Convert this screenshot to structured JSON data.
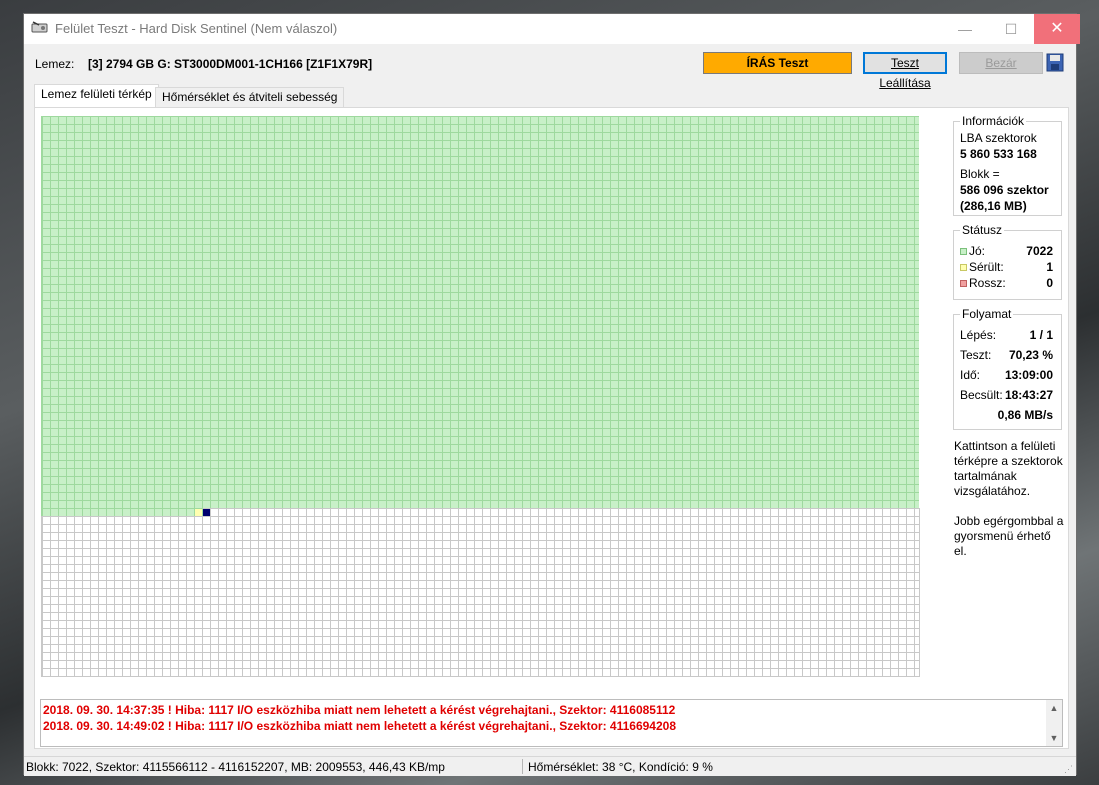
{
  "window": {
    "title": "Felület Teszt - Hard Disk Sentinel (Nem válaszol)",
    "minimize": "—",
    "maximize": "☐",
    "close": "✕"
  },
  "disk": {
    "label": "Lemez:",
    "value": "[3] 2794 GB G: ST3000DM001-1CH166 [Z1F1X79R]"
  },
  "buttons": {
    "test": "ÍRÁS Teszt",
    "stop": "Teszt Leállítása",
    "close": "Bezár"
  },
  "tabs": [
    {
      "label": "Lemez felületi térkép"
    },
    {
      "label": "Hőmérséklet és átviteli sebesség"
    }
  ],
  "info": {
    "title": "Információk",
    "lba_label": "LBA szektorok",
    "lba_value": "5 860 533 168",
    "block_label": "Blokk =",
    "block_value": "586 096 szektor",
    "block_mb": "(286,16 MB)"
  },
  "status": {
    "title": "Státusz",
    "good_label": "Jó:",
    "good_value": "7022",
    "damaged_label": "Sérült:",
    "damaged_value": "1",
    "bad_label": "Rossz:",
    "bad_value": "0"
  },
  "progress": {
    "title": "Folyamat",
    "step_label": "Lépés:",
    "step_value": "1 / 1",
    "test_label": "Teszt:",
    "test_value": "70,23 %",
    "time_label": "Idő:",
    "time_value": "13:09:00",
    "est_label": "Becsült:",
    "est_value": "18:43:27",
    "speed": "0,86 MB/s"
  },
  "hints": {
    "hint1": "Kattintson a felületi térképre a szektorok tartalmának vizsgálatához.",
    "hint2": "Jobb egérgombbal a gyorsmenü érhető el."
  },
  "log": [
    "2018. 09. 30.  14:37:35 ! Hiba: 1117 I/O eszközhiba miatt nem lehetett a kérést végrehajtani., Szektor: 4116085112",
    "2018. 09. 30.  14:49:02 ! Hiba: 1117 I/O eszközhiba miatt nem lehetett a kérést végrehajtani., Szektor: 4116694208"
  ],
  "statusbar": {
    "left": "Blokk: 7022, Szektor: 4115566112 - 4116152207, MB: 2009553, 446,43 KB/mp",
    "right": "Hőmérséklet: 38  °C,  Kondíció: 9 %"
  },
  "colors": {
    "good": "#c8f0c8",
    "damaged": "#ffffb0",
    "bad": "#f0a0a0",
    "current": "#00006e",
    "test_button": "#ffaa00",
    "error_text": "#e00000"
  }
}
